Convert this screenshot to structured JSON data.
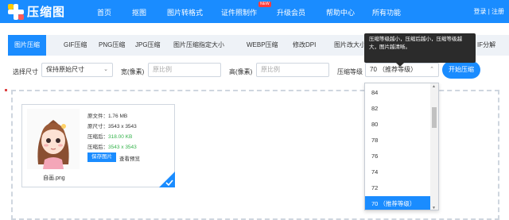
{
  "brand": {
    "name": "压缩图"
  },
  "nav": {
    "items": [
      "首页",
      "抠图",
      "图片转格式",
      "证件照制作",
      "升级会员",
      "帮助中心",
      "所有功能"
    ],
    "new_badge": "NEW",
    "login": "登录",
    "register": "注册"
  },
  "tabs": [
    "图片压缩",
    "GIF压缩",
    "PNG压缩",
    "JPG压缩",
    "图片压缩指定大小",
    "WEBP压缩",
    "修改DPI",
    "图片改大小",
    "IF分解"
  ],
  "options": {
    "size_label": "选择尺寸",
    "size_value": "保持原始尺寸",
    "width_label": "宽(像素)",
    "width_placeholder": "原比例",
    "height_label": "高(像素)",
    "height_placeholder": "原比例",
    "level_label": "压缩等级",
    "level_value": "70 （推荐等级）",
    "start_button": "开始压缩"
  },
  "tooltip": {
    "text": "压缩等级越小，压缩后越小，压缩等级越大，图片越清晰。"
  },
  "file": {
    "name": "自画.png",
    "original_size": "原文件：1.76 MB",
    "original_dim": "原尺寸：3543 x 3543",
    "compressed_size_label": "压缩后：",
    "compressed_size": "318.00 KB",
    "compressed_dim_label": "压缩后：",
    "compressed_dim": "3543 x 3543",
    "save_button": "保存图片",
    "preview_link": "查看预览"
  },
  "dropdown": {
    "items": [
      "84",
      "82",
      "80",
      "78",
      "76",
      "74",
      "72",
      "70 （推荐等级）"
    ],
    "selected_index": 7
  },
  "colors": {
    "brand": "#1a8cff",
    "green": "#33b24a",
    "badge": "#ff3b3b"
  }
}
